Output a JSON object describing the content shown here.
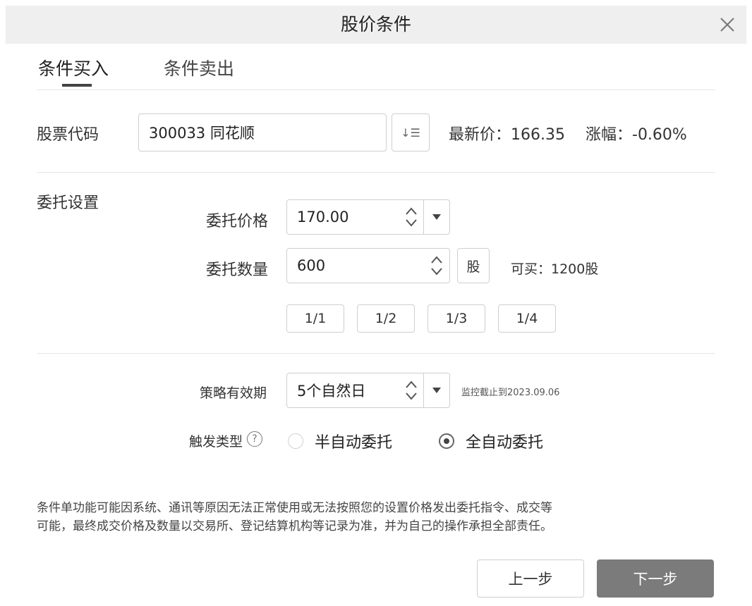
{
  "dialog": {
    "title": "股价条件"
  },
  "tabs": [
    {
      "label": "条件买入",
      "active": true
    },
    {
      "label": "条件卖出",
      "active": false
    }
  ],
  "stock": {
    "label": "股票代码",
    "value": "300033 同花顺",
    "sort_glyph": "↓☰",
    "latest_price": "最新价：166.35",
    "change": "涨幅：-0.60%"
  },
  "order": {
    "section_label": "委托设置",
    "price_label": "委托价格",
    "price_value": "170.00",
    "qty_label": "委托数量",
    "qty_value": "600",
    "unit": "股",
    "available": "可买：1200股",
    "fractions": [
      "1/1",
      "1/2",
      "1/3",
      "1/4"
    ]
  },
  "strategy": {
    "validity_label": "策略有效期",
    "validity_value": "5个自然日",
    "monitor_until": "监控截止到2023.09.06",
    "trigger_label": "触发类型",
    "help_glyph": "?",
    "options": [
      {
        "label": "半自动委托",
        "checked": false
      },
      {
        "label": "全自动委托",
        "checked": true
      }
    ]
  },
  "disclaimer": {
    "line1": "条件单功能可能因系统、通讯等原因无法正常使用或无法按照您的设置价格发出委托指令、成交等",
    "line2": "可能，最终成交价格及数量以交易所、登记结算机构等记录为准，并为自己的操作承担全部责任。"
  },
  "footer": {
    "prev": "上一步",
    "next": "下一步"
  },
  "colors": {
    "primary_button": "#7b7b7b",
    "title_bar": "#efefef",
    "border": "#cfcfcf"
  }
}
